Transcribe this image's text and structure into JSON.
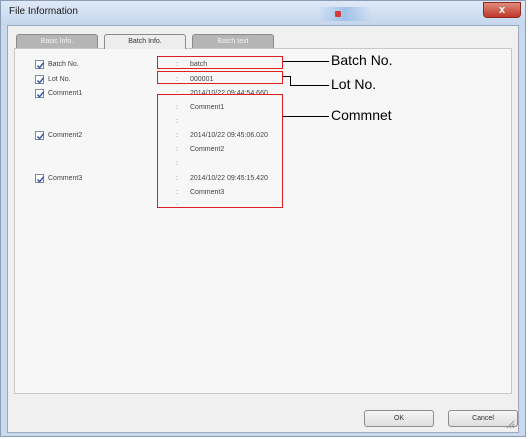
{
  "window": {
    "title": "File Information",
    "close_glyph": "x"
  },
  "tabs": [
    {
      "label": "Basic Info.",
      "active": false
    },
    {
      "label": "Batch Info.",
      "active": true
    },
    {
      "label": "Batch text",
      "active": false
    }
  ],
  "separator": ":",
  "fields": {
    "batch_no": {
      "label": "Batch No.",
      "checked": true,
      "value": "batch"
    },
    "lot_no": {
      "label": "Lot No.",
      "checked": true,
      "value": "000001"
    },
    "comment1": {
      "label": "Comment1",
      "checked": true,
      "timestamp": "2014/10/22 09:44:54.660",
      "text": "Comment1"
    },
    "comment2": {
      "label": "Comment2",
      "checked": true,
      "timestamp": "2014/10/22 09:45:06.020",
      "text": "Comment2"
    },
    "comment3": {
      "label": "Comment3",
      "checked": true,
      "timestamp": "2014/10/22 09:45:15.420",
      "text": "Comment3"
    }
  },
  "buttons": {
    "ok": "OK",
    "cancel": "Cancel"
  },
  "annotations": {
    "batch_no": "Batch No.",
    "lot_no": "Lot No.",
    "comment": "Commnet"
  },
  "colors": {
    "annotation_box": "#e02020",
    "tab_inactive": "#b5b5b5",
    "title_bar": "#c4d6ee"
  }
}
